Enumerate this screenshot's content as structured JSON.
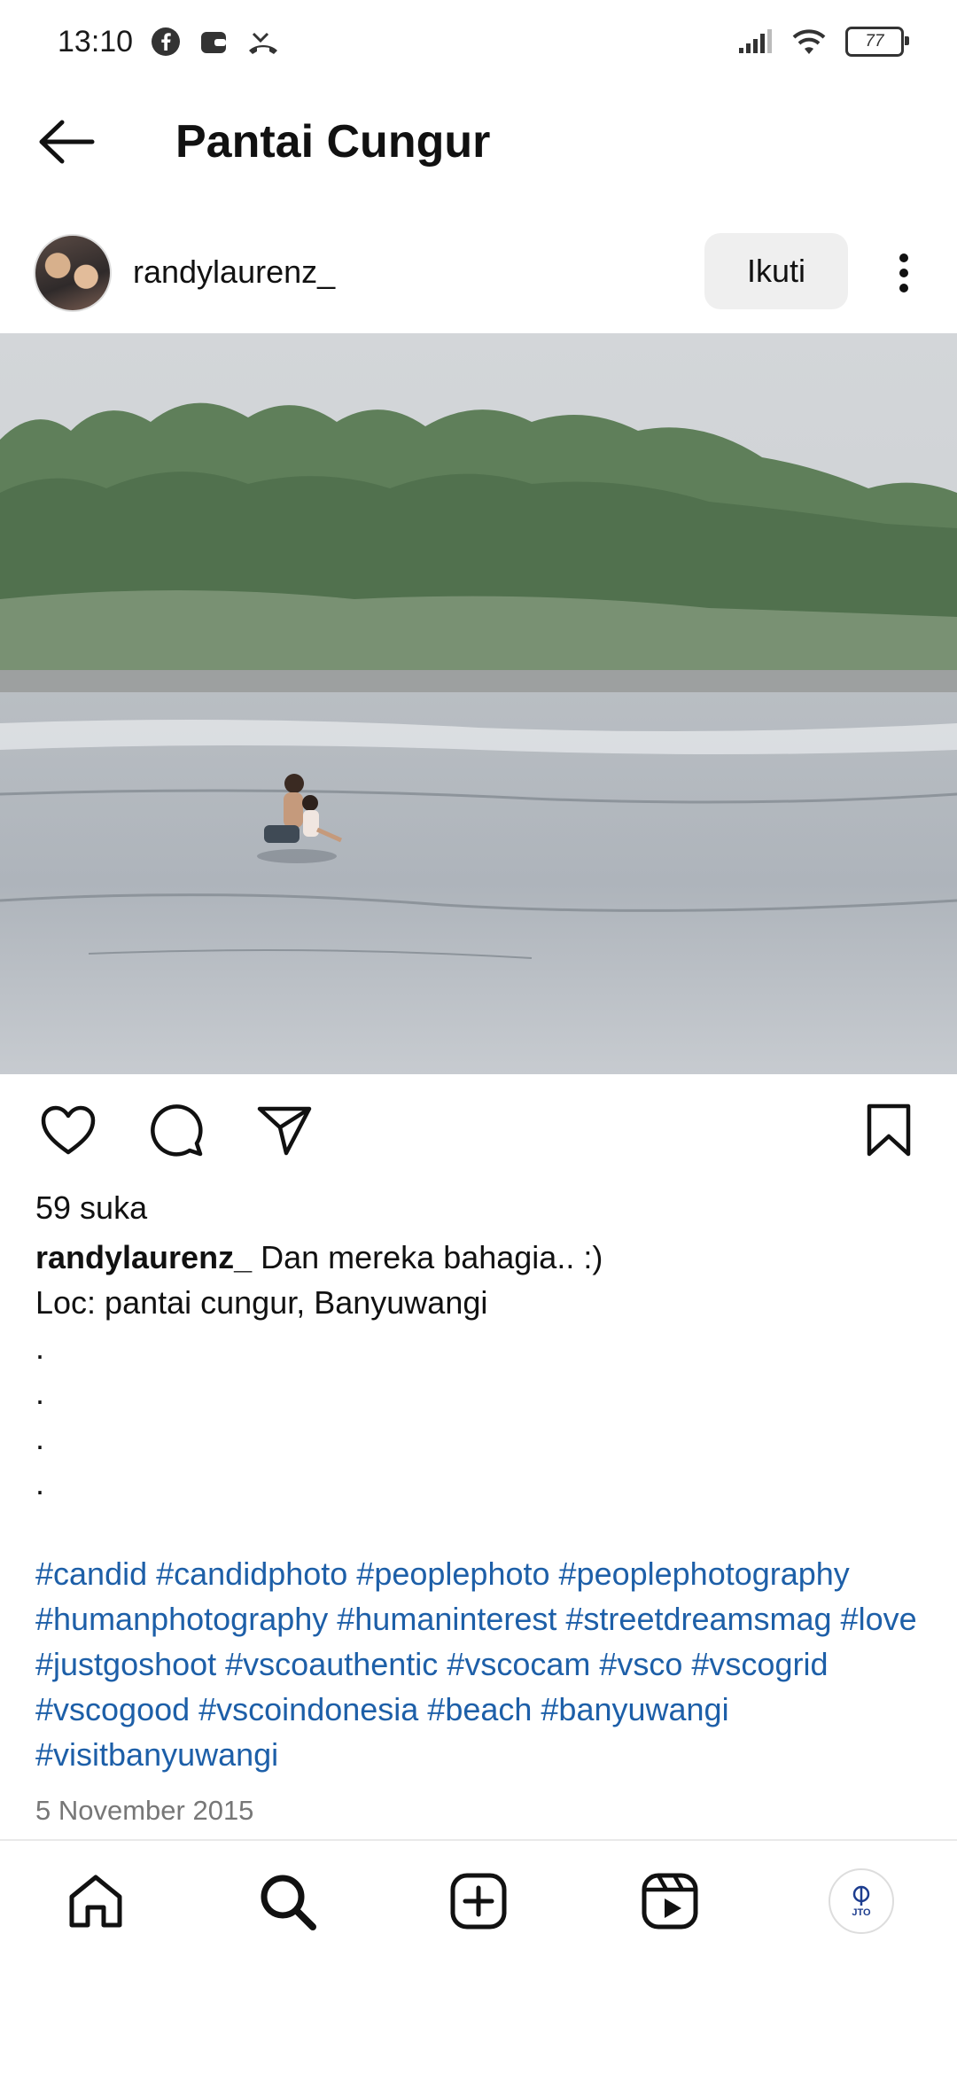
{
  "status_bar": {
    "time": "13:10",
    "battery": "77"
  },
  "header": {
    "title": "Pantai Cungur"
  },
  "post": {
    "username": "randylaurenz_",
    "follow_label": "Ikuti",
    "likes": "59 suka",
    "caption_user": "randylaurenz_",
    "caption_text": "Dan mereka bahagia.. :)",
    "location_line": "Loc: pantai cungur, Banyuwangi",
    "dots": [
      ".",
      ".",
      ".",
      "."
    ],
    "hashtags": "#candid #candidphoto #peoplephoto #peoplephotography #humanphotography #humaninterest #streetdreamsmag #love #justgoshoot #vscoauthentic #vscocam #vsco #vscogrid #vscogood #vscoindonesia #beach #banyuwangi #visitbanyuwangi",
    "date": "5 November 2015"
  },
  "bottom_nav": {
    "items": [
      "home-icon",
      "search-icon",
      "create-icon",
      "reels-icon",
      "profile-avatar"
    ],
    "profile_text": "JTO"
  },
  "colors": {
    "hashtag": "#1d5fa8",
    "follow_bg": "#efefef"
  }
}
